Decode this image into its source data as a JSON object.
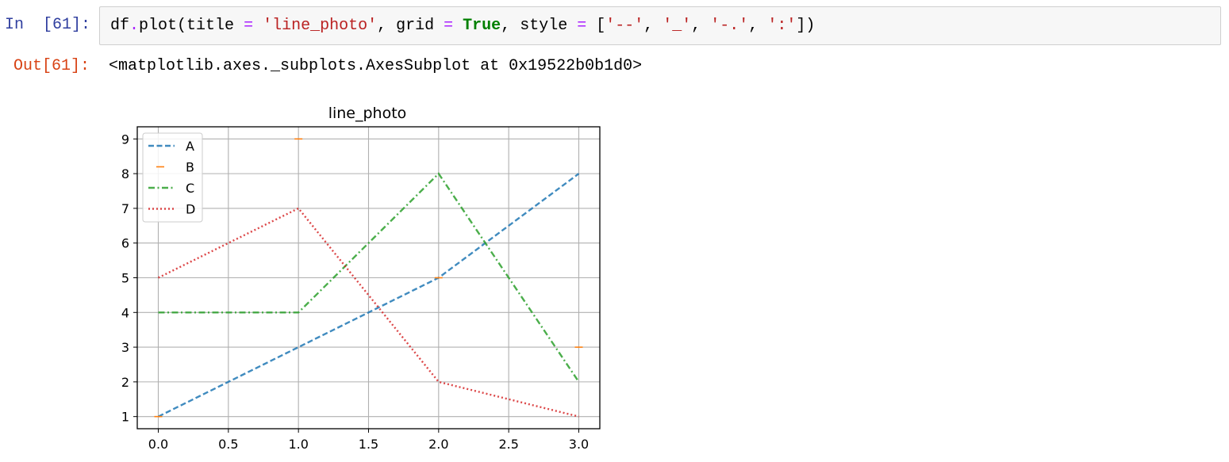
{
  "cell": {
    "input_prompt": "In  [61]:",
    "output_prompt": "Out[61]:",
    "code_tokens": [
      {
        "t": "df",
        "c": "plain"
      },
      {
        "t": ".",
        "c": "op"
      },
      {
        "t": "plot(title ",
        "c": "plain"
      },
      {
        "t": "=",
        "c": "op"
      },
      {
        "t": " ",
        "c": "plain"
      },
      {
        "t": "'line_photo'",
        "c": "str"
      },
      {
        "t": ", grid ",
        "c": "plain"
      },
      {
        "t": "=",
        "c": "op"
      },
      {
        "t": " ",
        "c": "plain"
      },
      {
        "t": "True",
        "c": "kw"
      },
      {
        "t": ", style ",
        "c": "plain"
      },
      {
        "t": "=",
        "c": "op"
      },
      {
        "t": " [",
        "c": "plain"
      },
      {
        "t": "'--'",
        "c": "str"
      },
      {
        "t": ", ",
        "c": "plain"
      },
      {
        "t": "'_'",
        "c": "str"
      },
      {
        "t": ", ",
        "c": "plain"
      },
      {
        "t": "'-.'",
        "c": "str"
      },
      {
        "t": ", ",
        "c": "plain"
      },
      {
        "t": "':'",
        "c": "str"
      },
      {
        "t": "])",
        "c": "plain"
      }
    ],
    "output_text": "<matplotlib.axes._subplots.AxesSubplot at 0x19522b0b1d0>"
  },
  "chart_data": {
    "type": "line",
    "title": "line_photo",
    "xlabel": "",
    "ylabel": "",
    "x": [
      0,
      1,
      2,
      3
    ],
    "xlim": [
      -0.15,
      3.15
    ],
    "ylim": [
      0.65,
      9.35
    ],
    "xticks": [
      0.0,
      0.5,
      1.0,
      1.5,
      2.0,
      2.5,
      3.0
    ],
    "xtick_labels": [
      "0.0",
      "0.5",
      "1.0",
      "1.5",
      "2.0",
      "2.5",
      "3.0"
    ],
    "yticks": [
      1,
      2,
      3,
      4,
      5,
      6,
      7,
      8,
      9
    ],
    "ytick_labels": [
      "1",
      "2",
      "3",
      "4",
      "5",
      "6",
      "7",
      "8",
      "9"
    ],
    "grid": true,
    "legend_position": "upper left",
    "series": [
      {
        "name": "A",
        "values": [
          1,
          3,
          5,
          8
        ],
        "color": "#1f77b4",
        "style": "dashed"
      },
      {
        "name": "B",
        "values": [
          1,
          9,
          5,
          3
        ],
        "color": "#ff7f0e",
        "style": "hline_marker"
      },
      {
        "name": "C",
        "values": [
          4,
          4,
          8,
          2
        ],
        "color": "#2ca02c",
        "style": "dashdot"
      },
      {
        "name": "D",
        "values": [
          5,
          7,
          2,
          1
        ],
        "color": "#d62728",
        "style": "dotted"
      }
    ]
  }
}
